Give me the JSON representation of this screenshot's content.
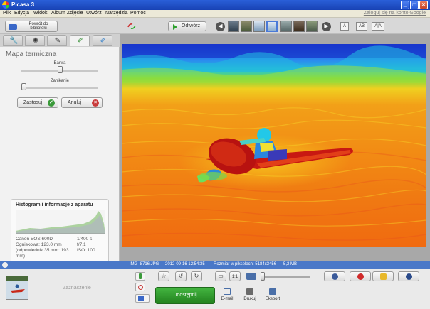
{
  "window": {
    "title": "Picasa 3"
  },
  "menu": {
    "items": [
      "Plik",
      "Edycja",
      "Widok",
      "Album",
      "Zdjęcie",
      "Utwórz",
      "Narzędzia",
      "Pomoc"
    ],
    "signin": "Zaloguj się na konto Google"
  },
  "toolbar": {
    "back_label": "Powrót do biblioteki",
    "open_label": "Odtwórz",
    "view_buttons": [
      "A",
      "AB",
      "A|A"
    ]
  },
  "left_panel": {
    "title": "Mapa termiczna",
    "slider_hue_label": "Barwa",
    "slider_fade_label": "Zanikanie",
    "hue_value": 0.5,
    "fade_value": 0.0,
    "apply_label": "Zastosuj",
    "cancel_label": "Anuluj",
    "histogram_title": "Histogram i informacje z aparatu",
    "exif_left": [
      "Canon EOS 600D",
      "Ogniskowa: 123.0 mm",
      "(odpowiednik 35 mm: 193",
      "mm)"
    ],
    "exif_right": [
      "1/400 s",
      "f/7.1",
      "ISO: 100"
    ]
  },
  "status": {
    "filename": "IMG_8716.JPG",
    "datetime": "2012-09-16 12:54:35",
    "pixels": "Rozmiar w pikselach: 5184x3456",
    "size": "5,2 MB"
  },
  "tray": {
    "selection_label": "Zaznaczenie",
    "share_label": "Udostępnij",
    "email_label": "E-mail",
    "print_label": "Drukuj",
    "export_label": "Eksport"
  },
  "colors": {
    "title_bar": "#1f4fc7",
    "status_bar": "#4a78c8",
    "share_green": "#2f9a2a"
  }
}
